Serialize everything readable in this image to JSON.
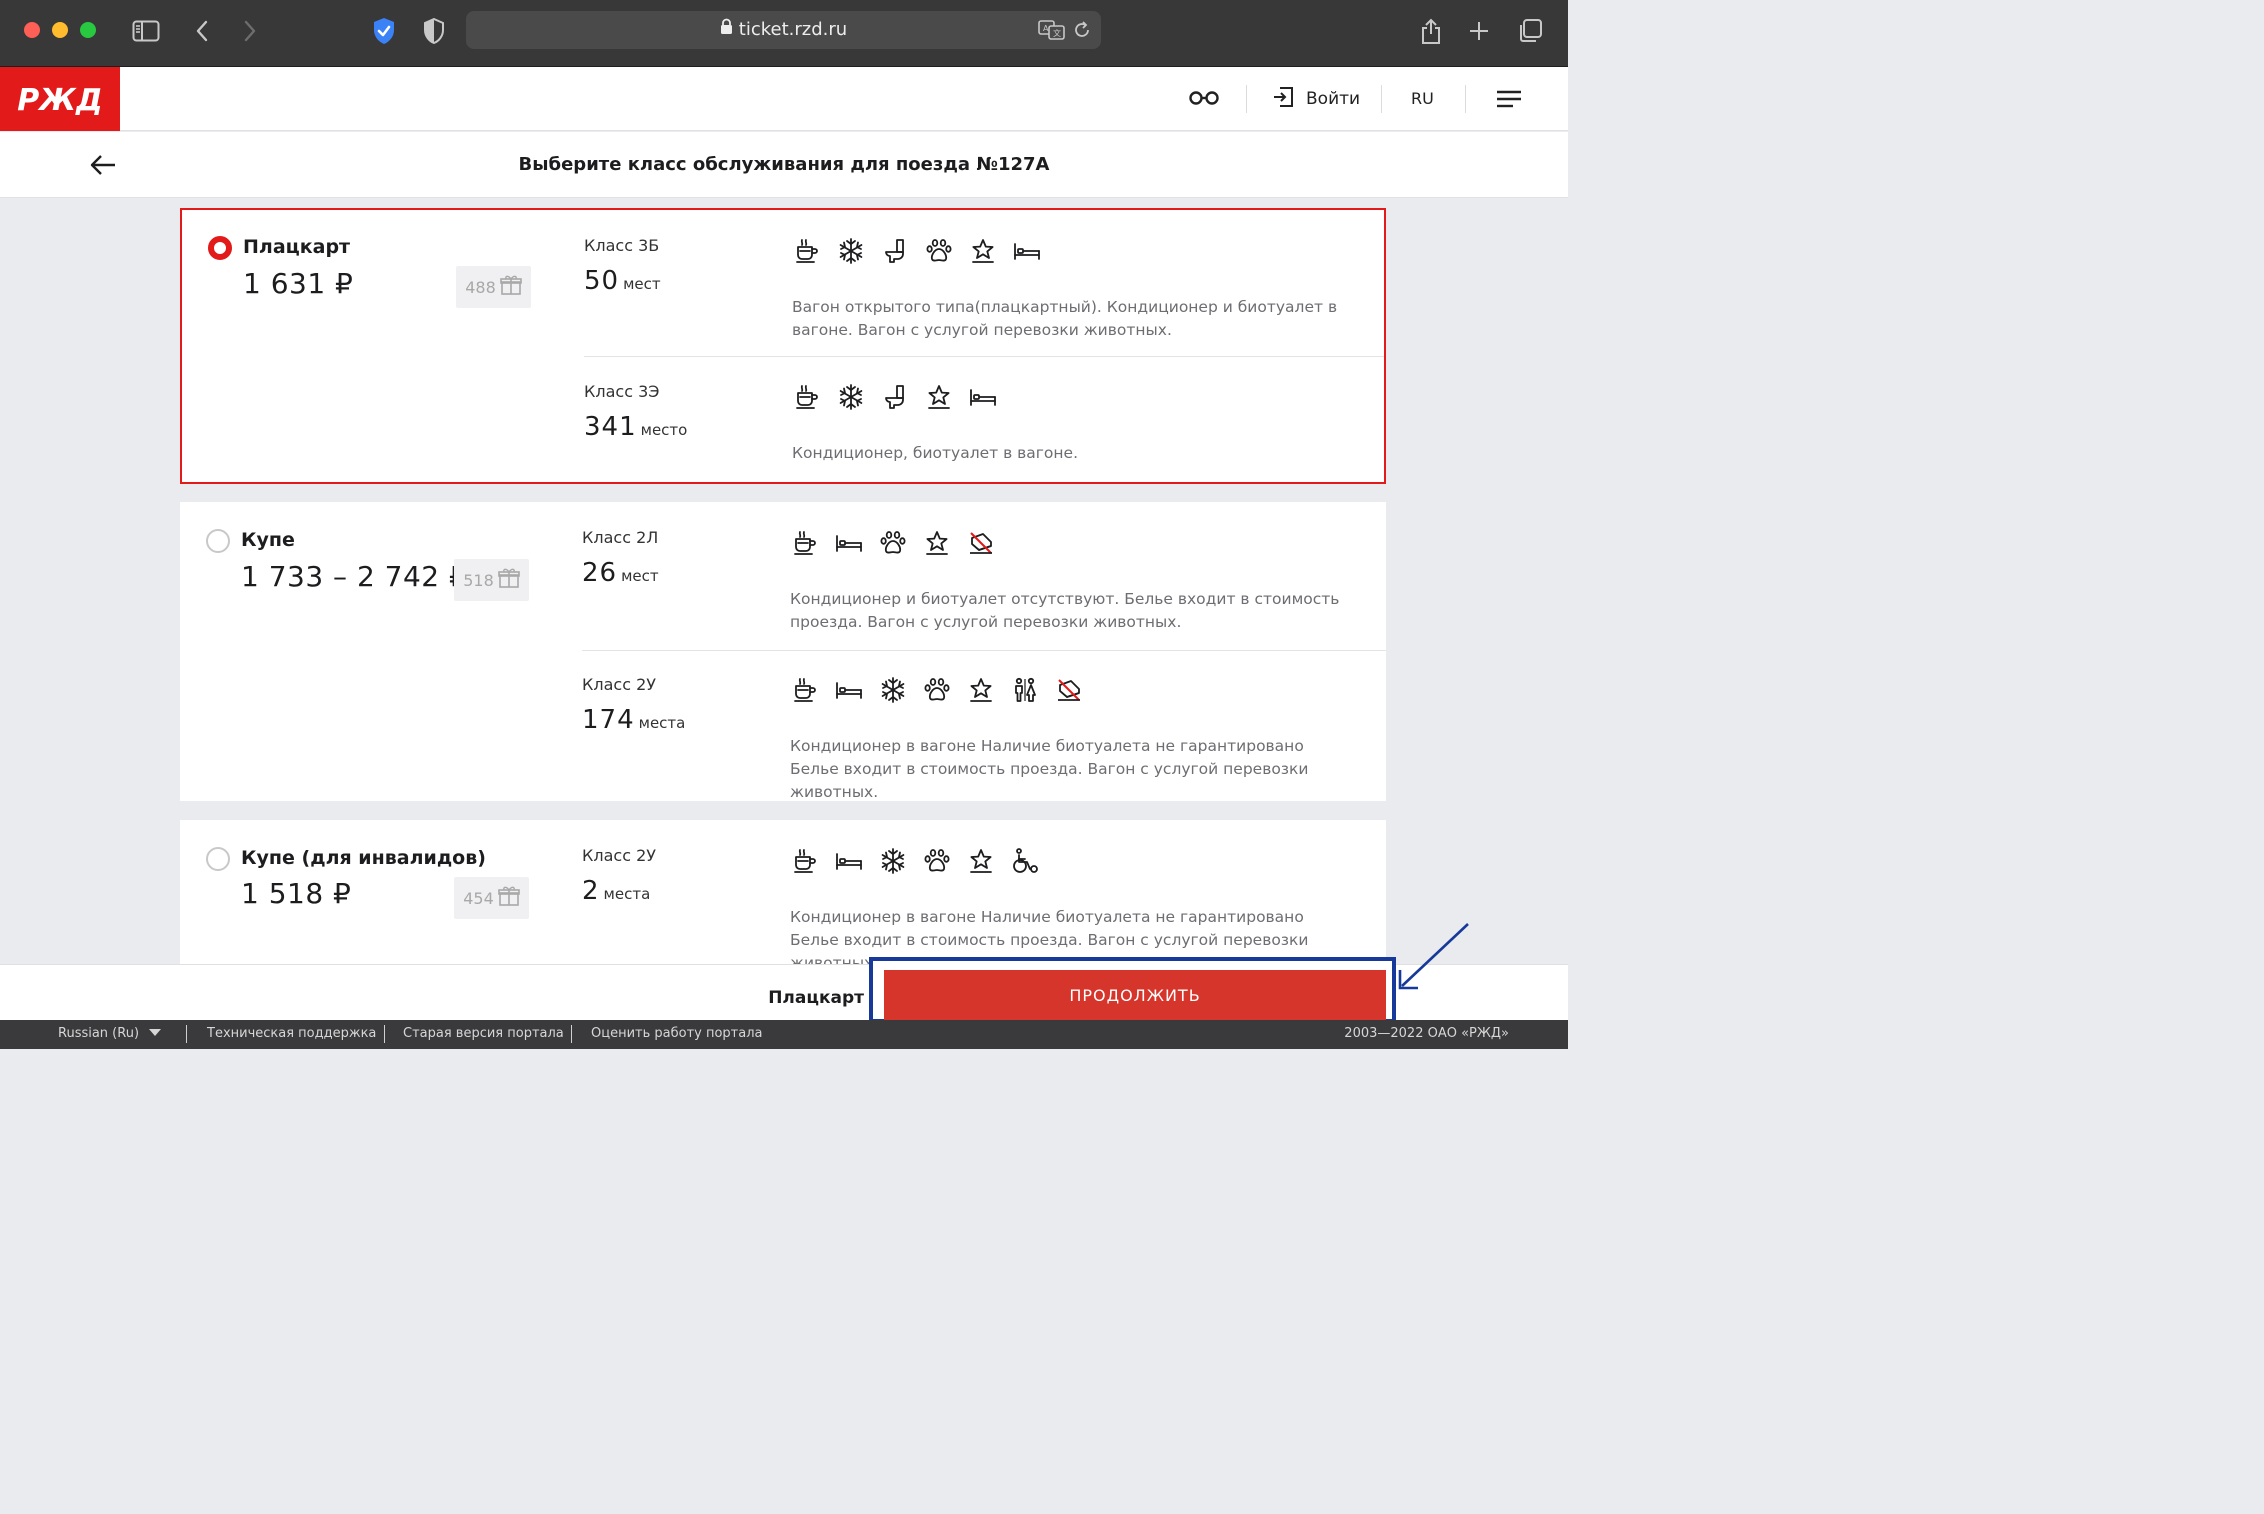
{
  "browser": {
    "url": "ticket.rzd.ru",
    "traffic_colors": [
      "#fe5f57",
      "#febc2e",
      "#28c840"
    ]
  },
  "header": {
    "logo_text": "РЖД",
    "login_label": "Войти",
    "lang_label": "RU"
  },
  "page": {
    "title": "Выберите класс обслуживания для поезда №127А"
  },
  "options": [
    {
      "name": "Плацкарт",
      "price": "1 631 ₽",
      "bonus": "488",
      "selected": true,
      "subclasses": [
        {
          "class": "Класс 3Б",
          "seats": "50",
          "seats_unit": "мест",
          "amenities": [
            "food-icon",
            "snowflake-icon",
            "toilet-icon",
            "paw-icon",
            "star-icon",
            "bed-icon"
          ],
          "description": "Вагон открытого типа(плацкартный). Кондиционер и биотуалет в вагоне. Вагон с услугой перевозки животных."
        },
        {
          "class": "Класс 3Э",
          "seats": "341",
          "seats_unit": "место",
          "amenities": [
            "food-icon",
            "snowflake-icon",
            "toilet-icon",
            "star-icon",
            "bed-icon"
          ],
          "description": "Кондиционер, биотуалет в вагоне."
        }
      ]
    },
    {
      "name": "Купе",
      "price": "1 733 – 2 742 ₽",
      "bonus": "518",
      "selected": false,
      "subclasses": [
        {
          "class": "Класс 2Л",
          "seats": "26",
          "seats_unit": "мест",
          "amenities": [
            "food-icon",
            "bed-icon",
            "paw-icon",
            "star-icon",
            "no-linen-icon"
          ],
          "description": "Кондиционер и биотуалет отсутствуют. Белье входит в стоимость проезда. Вагон с услугой перевозки животных."
        },
        {
          "class": "Класс 2У",
          "seats": "174",
          "seats_unit": "места",
          "amenities": [
            "food-icon",
            "bed-icon",
            "snowflake-icon",
            "paw-icon",
            "star-icon",
            "mixed-gender-icon",
            "no-linen-icon"
          ],
          "description": "Кондиционер в вагоне Наличие биотуалета не гарантировано Белье входит в стоимость проезда. Вагон с услугой перевозки животных."
        }
      ]
    },
    {
      "name": "Купе (для инвалидов)",
      "price": "1 518 ₽",
      "bonus": "454",
      "selected": false,
      "subclasses": [
        {
          "class": "Класс 2У",
          "seats": "2",
          "seats_unit": "места",
          "amenities": [
            "food-icon",
            "bed-icon",
            "snowflake-icon",
            "paw-icon",
            "star-icon",
            "wheelchair-icon"
          ],
          "description": "Кондиционер в вагоне Наличие биотуалета не гарантировано Белье входит в стоимость проезда. Вагон с услугой перевозки животных."
        }
      ]
    }
  ],
  "bottom": {
    "selected_label": "Плацкарт",
    "cta_label": "ПРОДОЛЖИТЬ"
  },
  "footer": {
    "language": "Russian  (Ru)",
    "links": [
      "Техническая поддержка",
      "Старая версия портала",
      "Оценить работу портала"
    ],
    "copyright": "2003—2022 ОАО «РЖД»"
  },
  "colors": {
    "brand_red": "#e21a1a",
    "cta_red": "#d5352b",
    "annotation_blue": "#173a9a"
  }
}
